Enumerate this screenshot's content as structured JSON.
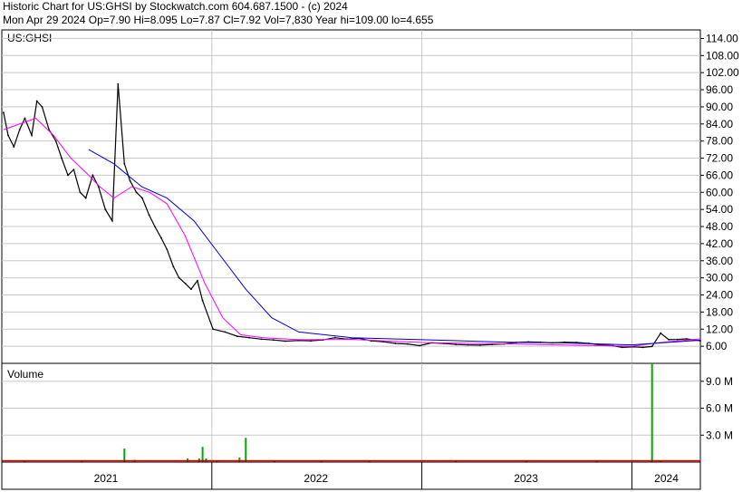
{
  "header": {
    "line1": "Historic Chart for US:GHSI by Stockwatch.com 604.687.1500 - (c) 2024",
    "line2": "Mon Apr 29 2024  Op=7.90  Hi=8.095  Lo=7.87  Cl=7.92  Vol=7,830  Year hi=109.00  lo=4.655"
  },
  "colors": {
    "price": "#000000",
    "ma_short": "#ff00ff",
    "ma_long": "#0000cc",
    "down_days": "#cc0000",
    "volume": "#00aa00",
    "grid": "#c8c8c8"
  },
  "chart_data": [
    {
      "type": "line",
      "panel": "price",
      "title": "US:GHSI",
      "y_tick_labels": [
        "114.00",
        "108.00",
        "102.00",
        "96.00",
        "90.00",
        "84.00",
        "78.00",
        "72.00",
        "66.00",
        "60.00",
        "54.00",
        "48.00",
        "42.00",
        "36.00",
        "30.00",
        "24.00",
        "18.00",
        "12.00",
        "6.00"
      ],
      "ylim": [
        0,
        117
      ],
      "x_tick_labels": [
        "2021",
        "2022",
        "2023",
        "2024"
      ],
      "xlim": [
        "2021-01-01",
        "2024-04-29"
      ],
      "grid": true,
      "series": [
        {
          "role": "price",
          "x": [
            "2021-01-04",
            "2021-01-12",
            "2021-01-22",
            "2021-02-01",
            "2021-02-10",
            "2021-02-22",
            "2021-03-03",
            "2021-03-12",
            "2021-03-24",
            "2021-04-05",
            "2021-04-15",
            "2021-04-26",
            "2021-05-06",
            "2021-05-17",
            "2021-05-27",
            "2021-06-08",
            "2021-06-18",
            "2021-06-30",
            "2021-07-12",
            "2021-07-22",
            "2021-08-02",
            "2021-08-12",
            "2021-08-23",
            "2021-09-02",
            "2021-09-14",
            "2021-09-24",
            "2021-10-05",
            "2021-10-15",
            "2021-10-26",
            "2021-11-05",
            "2021-11-16",
            "2021-11-26",
            "2021-12-07",
            "2021-12-16",
            "2022-01-03",
            "2022-01-24",
            "2022-02-14",
            "2022-03-07",
            "2022-03-28",
            "2022-04-18",
            "2022-05-09",
            "2022-06-01",
            "2022-06-22",
            "2022-07-13",
            "2022-08-03",
            "2022-08-24",
            "2022-09-14",
            "2022-10-05",
            "2022-10-26",
            "2022-11-16",
            "2022-12-07",
            "2022-12-28",
            "2023-01-18",
            "2023-02-08",
            "2023-03-01",
            "2023-03-22",
            "2023-04-12",
            "2023-05-03",
            "2023-05-24",
            "2023-06-14",
            "2023-07-05",
            "2023-07-26",
            "2023-08-16",
            "2023-09-06",
            "2023-09-27",
            "2023-10-18",
            "2023-11-08",
            "2023-11-29",
            "2023-12-15",
            "2024-01-05",
            "2024-01-20",
            "2024-02-05",
            "2024-02-20",
            "2024-03-05",
            "2024-03-20",
            "2024-04-05",
            "2024-04-29"
          ],
          "values": [
            88,
            80,
            76,
            82,
            86,
            80,
            92,
            90,
            82,
            78,
            72,
            66,
            68,
            60,
            58,
            66,
            62,
            54,
            50,
            98,
            70,
            64,
            60,
            58,
            52,
            48,
            44,
            40,
            34,
            30,
            28,
            26,
            29,
            22,
            12,
            11,
            9.5,
            9,
            8.5,
            8.2,
            7.8,
            8,
            7.9,
            8.2,
            9,
            8.5,
            8.8,
            7.9,
            7.6,
            7,
            6.8,
            6.2,
            7.2,
            7,
            6.6,
            6.5,
            6.4,
            6.6,
            6.8,
            7.3,
            7.5,
            7.4,
            7.2,
            7.4,
            7.3,
            7,
            6.5,
            6.2,
            5.6,
            5.8,
            5.6,
            5.9,
            10.6,
            8.3,
            8.4,
            8.6,
            7.92
          ]
        },
        {
          "role": "moving average (short)",
          "x": [
            "2021-01-04",
            "2021-03-01",
            "2021-04-01",
            "2021-05-01",
            "2021-06-01",
            "2021-06-20",
            "2021-07-15",
            "2021-08-15",
            "2021-09-15",
            "2021-10-15",
            "2021-11-15",
            "2021-12-20",
            "2022-01-20",
            "2022-02-20",
            "2022-04-01",
            "2022-06-01",
            "2022-09-01",
            "2023-01-01",
            "2023-06-01",
            "2024-01-01",
            "2024-02-20",
            "2024-04-29"
          ],
          "values": [
            82,
            86,
            80,
            72,
            66,
            62,
            58,
            62,
            60,
            56,
            45,
            28,
            16,
            10,
            9,
            8.3,
            8.4,
            7.3,
            6.8,
            6.0,
            7.3,
            8.6
          ]
        },
        {
          "role": "moving average (long)",
          "x": [
            "2021-06-01",
            "2021-07-15",
            "2021-09-01",
            "2021-10-15",
            "2021-12-01",
            "2022-01-15",
            "2022-03-01",
            "2022-04-15",
            "2022-06-01",
            "2022-09-01",
            "2023-01-01",
            "2023-06-01",
            "2023-09-01",
            "2024-01-01",
            "2024-03-01",
            "2024-04-29"
          ],
          "values": [
            75,
            70,
            62,
            58,
            50,
            38,
            26,
            16,
            11,
            9,
            8.3,
            7.4,
            7.2,
            6.5,
            7.3,
            8.1
          ]
        }
      ]
    },
    {
      "type": "bar",
      "panel": "volume",
      "title": "Volume",
      "y_tick_labels": [
        "9.0 M",
        "6.0 M",
        "3.0 M"
      ],
      "ylim": [
        0,
        11000000
      ],
      "x_tick_labels": [
        "2021",
        "2022",
        "2023",
        "2024"
      ],
      "x": [
        "2021-02-10",
        "2021-05-20",
        "2021-08-02",
        "2021-08-20",
        "2021-11-20",
        "2021-12-10",
        "2021-12-16",
        "2021-12-22",
        "2022-01-10",
        "2022-02-18",
        "2022-03-01",
        "2022-04-20",
        "2022-07-10",
        "2022-10-02",
        "2023-03-01",
        "2023-07-01",
        "2023-11-01",
        "2024-02-05",
        "2024-02-20"
      ],
      "values": [
        200000,
        150000,
        1500000,
        250000,
        400000,
        400000,
        1700000,
        400000,
        200000,
        500000,
        2700000,
        150000,
        150000,
        150000,
        100000,
        100000,
        100000,
        11000000,
        200000
      ]
    }
  ]
}
